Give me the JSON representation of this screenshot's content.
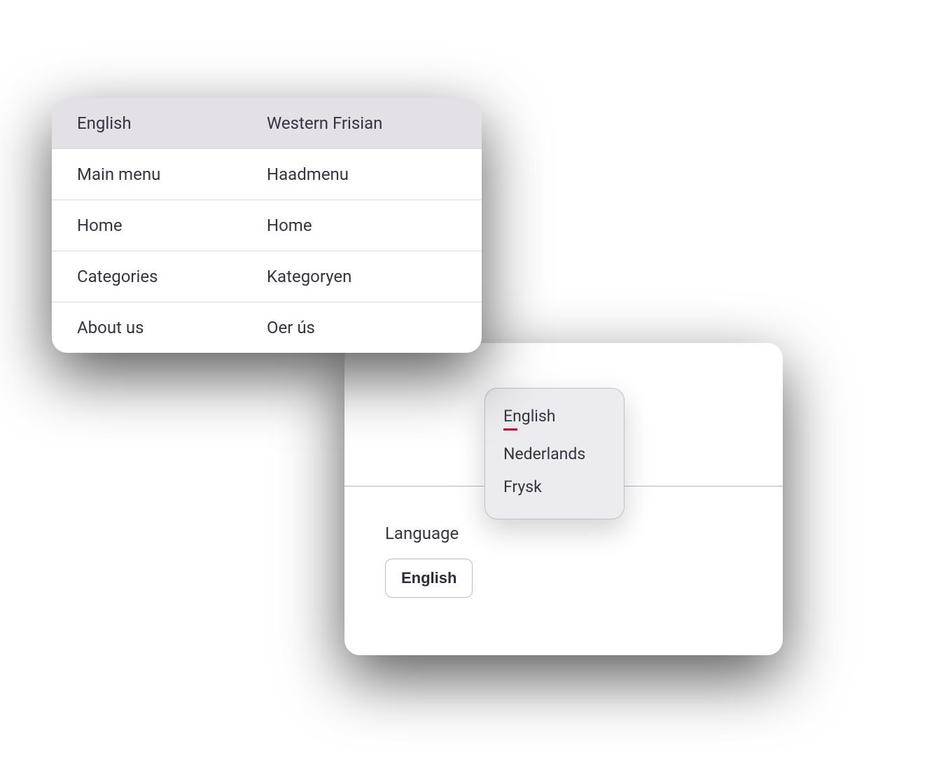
{
  "translation_table": {
    "headers": {
      "source": "English",
      "target": "Western Frisian"
    },
    "rows": [
      {
        "source": "Main menu",
        "target": "Haadmenu"
      },
      {
        "source": "Home",
        "target": "Home"
      },
      {
        "source": "Categories",
        "target": "Kategoryen"
      },
      {
        "source": "About us",
        "target": "Oer ús"
      }
    ]
  },
  "language_section": {
    "label": "Language",
    "button_label": "English",
    "dropdown": {
      "options": [
        {
          "label": "English",
          "selected": true
        },
        {
          "label": "Nederlands",
          "selected": false
        },
        {
          "label": "Frysk",
          "selected": false
        }
      ]
    }
  }
}
